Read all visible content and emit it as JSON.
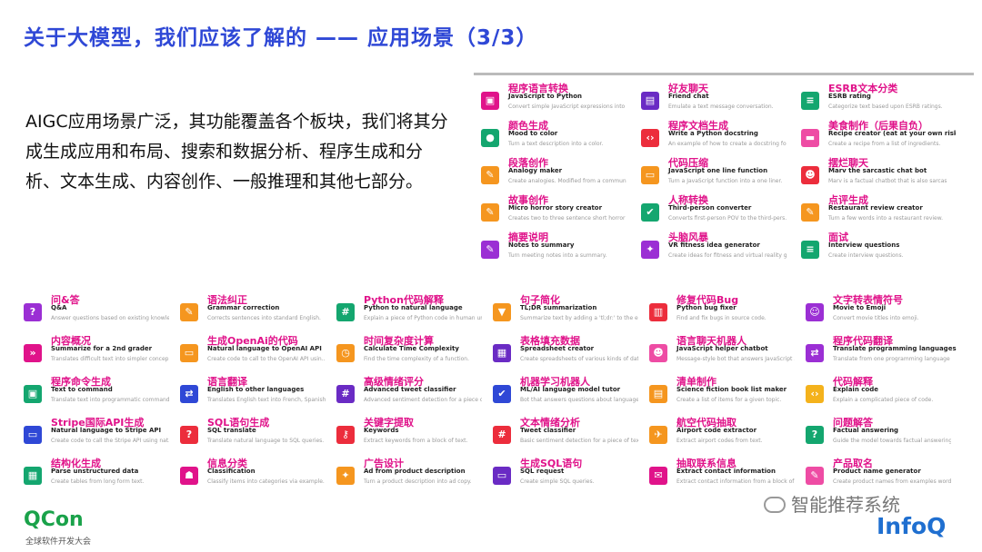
{
  "title": "关于大模型，我们应该了解的 —— 应用场景（3/3）",
  "intro": "AIGC应用场景广泛，其功能覆盖各个板块，我们将其分成生成应用和布局、搜索和数据分析、程序生成和分析、文本生成、内容创作、一般推理和其他七部分。",
  "top_apps": [
    {
      "zh": "程序语言转换",
      "en": "JavaScript to Python",
      "desc": "Convert simple JavaScript expressions into ...",
      "icon": "code-icon",
      "color": "#e0138a",
      "glyph": "▣"
    },
    {
      "zh": "好友聊天",
      "en": "Friend chat",
      "desc": "Emulate a text message conversation.",
      "icon": "chat-icon",
      "color": "#6a2bc4",
      "glyph": "▤"
    },
    {
      "zh": "ESRB文本分类",
      "en": "ESRB rating",
      "desc": "Categorize text based upon ESRB ratings.",
      "icon": "rating-icon",
      "color": "#14a66f",
      "glyph": "≡"
    },
    {
      "zh": "颜色生成",
      "en": "Mood to color",
      "desc": "Turn a text description into a color.",
      "icon": "palette-icon",
      "color": "#14a66f",
      "glyph": "●"
    },
    {
      "zh": "程序文档生成",
      "en": "Write a Python docstring",
      "desc": "An example of how to create a docstring for ...",
      "icon": "code-tag-icon",
      "color": "#ec2d3c",
      "glyph": "‹›"
    },
    {
      "zh": "美食制作（后果自负）",
      "en": "Recipe creator (eat at your own risk)",
      "desc": "Create a recipe from a list of ingredients.",
      "icon": "recipe-icon",
      "color": "#ee4ca4",
      "glyph": "▬"
    },
    {
      "zh": "段落创作",
      "en": "Analogy maker",
      "desc": "Create analogies. Modified from a communi...",
      "icon": "analogy-icon",
      "color": "#f5961f",
      "glyph": "✎"
    },
    {
      "zh": "代码压缩",
      "en": "JavaScript one line function",
      "desc": "Turn a JavaScript function into a one liner.",
      "icon": "compress-icon",
      "color": "#f5961f",
      "glyph": "▭"
    },
    {
      "zh": "摆烂聊天",
      "en": "Marv the sarcastic chat bot",
      "desc": "Marv is a factual chatbot that is also sarcas...",
      "icon": "bot-icon",
      "color": "#ec2d3c",
      "glyph": "☻"
    },
    {
      "zh": "故事创作",
      "en": "Micro horror story creator",
      "desc": "Creates two to three sentence short horror ...",
      "icon": "story-icon",
      "color": "#f5961f",
      "glyph": "✎"
    },
    {
      "zh": "人称转换",
      "en": "Third-person converter",
      "desc": "Converts first-person POV to the third-pers...",
      "icon": "convert-icon",
      "color": "#14a66f",
      "glyph": "✔"
    },
    {
      "zh": "点评生成",
      "en": "Restaurant review creator",
      "desc": "Turn a few words into a restaurant review.",
      "icon": "review-icon",
      "color": "#f5961f",
      "glyph": "✎"
    },
    {
      "zh": "摘要说明",
      "en": "Notes to summary",
      "desc": "Turn meeting notes into a summary.",
      "icon": "notes-icon",
      "color": "#9b2fd4",
      "glyph": "✎"
    },
    {
      "zh": "头脑风暴",
      "en": "VR fitness idea generator",
      "desc": "Create ideas for fitness and virtual reality g...",
      "icon": "idea-icon",
      "color": "#9b2fd4",
      "glyph": "✦"
    },
    {
      "zh": "面试",
      "en": "Interview questions",
      "desc": "Create interview questions.",
      "icon": "interview-icon",
      "color": "#14a66f",
      "glyph": "≡"
    }
  ],
  "bottom_apps": [
    {
      "zh": "问&答",
      "en": "Q&A",
      "desc": "Answer questions based on existing knowle...",
      "icon": "question-icon",
      "color": "#9b2fd4",
      "glyph": "?"
    },
    {
      "zh": "语法纠正",
      "en": "Grammar correction",
      "desc": "Corrects sentences into standard English.",
      "icon": "grammar-icon",
      "color": "#f5961f",
      "glyph": "✎"
    },
    {
      "zh": "Python代码解释",
      "en": "Python to natural language",
      "desc": "Explain a piece of Python code in human un...",
      "icon": "hash-icon",
      "color": "#14a66f",
      "glyph": "#"
    },
    {
      "zh": "句子简化",
      "en": "TL;DR summarization",
      "desc": "Summarize text by adding a 'tl;dr:' to the en...",
      "icon": "filter-icon",
      "color": "#f5961f",
      "glyph": "▼"
    },
    {
      "zh": "修复代码Bug",
      "en": "Python bug fixer",
      "desc": "Find and fix bugs in source code.",
      "icon": "bug-icon",
      "color": "#ec2d3c",
      "glyph": "▥"
    },
    {
      "zh": "文字转表情符号",
      "en": "Movie to Emoji",
      "desc": "Convert movie titles into emoji.",
      "icon": "emoji-icon",
      "color": "#9b2fd4",
      "glyph": "☺"
    },
    {
      "zh": "内容概况",
      "en": "Summarize for a 2nd grader",
      "desc": "Translates difficult text into simpler concep...",
      "icon": "summary-icon",
      "color": "#e0138a",
      "glyph": "»"
    },
    {
      "zh": "生成OpenAi的代码",
      "en": "Natural language to OpenAI API",
      "desc": "Create code to call to the OpenAI API usin...",
      "icon": "api-icon",
      "color": "#f5961f",
      "glyph": "▭"
    },
    {
      "zh": "时间复杂度计算",
      "en": "Calculate Time Complexity",
      "desc": "Find the time complexity of a function.",
      "icon": "clock-icon",
      "color": "#f5961f",
      "glyph": "◷"
    },
    {
      "zh": "表格填充数据",
      "en": "Spreadsheet creator",
      "desc": "Create spreadsheets of various kinds of dat...",
      "icon": "table-icon",
      "color": "#6a2bc4",
      "glyph": "▦"
    },
    {
      "zh": "语言聊天机器人",
      "en": "JavaScript helper chatbot",
      "desc": "Message-style bot that answers JavaScript ...",
      "icon": "chatbot-icon",
      "color": "#ee4ca4",
      "glyph": "☻"
    },
    {
      "zh": "程序代码翻译",
      "en": "Translate programming languages",
      "desc": "Translate from one programming language ...",
      "icon": "translate-code-icon",
      "color": "#9b2fd4",
      "glyph": "⇄"
    },
    {
      "zh": "程序命令生成",
      "en": "Text to command",
      "desc": "Translate text into programmatic commands.",
      "icon": "terminal-icon",
      "color": "#14a66f",
      "glyph": "▣"
    },
    {
      "zh": "语言翻译",
      "en": "English to other languages",
      "desc": "Translates English text into French, Spanish...",
      "icon": "translate-icon",
      "color": "#2f48d6",
      "glyph": "⇄"
    },
    {
      "zh": "高级情绪评分",
      "en": "Advanced tweet classifier",
      "desc": "Advanced sentiment detection for a piece o...",
      "icon": "sentiment-icon",
      "color": "#6a2bc4",
      "glyph": "#"
    },
    {
      "zh": "机器学习机器人",
      "en": "ML/AI language model tutor",
      "desc": "Bot that answers questions about language...",
      "icon": "tutor-icon",
      "color": "#2f48d6",
      "glyph": "✔"
    },
    {
      "zh": "清单制作",
      "en": "Science fiction book list maker",
      "desc": "Create a list of items for a given topic.",
      "icon": "list-icon",
      "color": "#f5961f",
      "glyph": "▤"
    },
    {
      "zh": "代码解释",
      "en": "Explain code",
      "desc": "Explain a complicated piece of code.",
      "icon": "explain-icon",
      "color": "#f4b21c",
      "glyph": "‹›"
    },
    {
      "zh": "Stripe国际API生成",
      "en": "Natural language to Stripe API",
      "desc": "Create code to call the Stripe API using nat...",
      "icon": "stripe-icon",
      "color": "#2f48d6",
      "glyph": "▭"
    },
    {
      "zh": "SQL语句生成",
      "en": "SQL translate",
      "desc": "Translate natural language to SQL queries.",
      "icon": "sql-icon",
      "color": "#ec2d3c",
      "glyph": "?"
    },
    {
      "zh": "关键字提取",
      "en": "Keywords",
      "desc": "Extract keywords from a block of text.",
      "icon": "keyword-icon",
      "color": "#ec2d3c",
      "glyph": "⚷"
    },
    {
      "zh": "文本情绪分析",
      "en": "Tweet classifier",
      "desc": "Basic sentiment detection for a piece of text.",
      "icon": "tweet-icon",
      "color": "#ec2d3c",
      "glyph": "#"
    },
    {
      "zh": "航空代码抽取",
      "en": "Airport code extractor",
      "desc": "Extract airport codes from text.",
      "icon": "airport-icon",
      "color": "#f5961f",
      "glyph": "✈"
    },
    {
      "zh": "问题解答",
      "en": "Factual answering",
      "desc": "Guide the model towards factual answering.",
      "icon": "answer-icon",
      "color": "#14a66f",
      "glyph": "?"
    },
    {
      "zh": "结构化生成",
      "en": "Parse unstructured data",
      "desc": "Create tables from long form text.",
      "icon": "parse-icon",
      "color": "#14a66f",
      "glyph": "▦"
    },
    {
      "zh": "信息分类",
      "en": "Classification",
      "desc": "Classify items into categories via example.",
      "icon": "classify-icon",
      "color": "#e0138a",
      "glyph": "☗"
    },
    {
      "zh": "广告设计",
      "en": "Ad from product description",
      "desc": "Turn a product description into ad copy.",
      "icon": "ad-icon",
      "color": "#f5961f",
      "glyph": "✦"
    },
    {
      "zh": "生成SQL语句",
      "en": "SQL request",
      "desc": "Create simple SQL queries.",
      "icon": "sql-request-icon",
      "color": "#6a2bc4",
      "glyph": "▭"
    },
    {
      "zh": "抽取联系信息",
      "en": "Extract contact information",
      "desc": "Extract contact information from a block of t...",
      "icon": "contact-icon",
      "color": "#e0138a",
      "glyph": "✉"
    },
    {
      "zh": "产品取名",
      "en": "Product name generator",
      "desc": "Create product names from examples word...",
      "icon": "product-icon",
      "color": "#ee4ca4",
      "glyph": "✎"
    }
  ],
  "footer": {
    "logo": "QCon",
    "logo_sub": "全球软件开发大会",
    "wechat": "智能推荐系统",
    "infoq": "InfoQ"
  }
}
